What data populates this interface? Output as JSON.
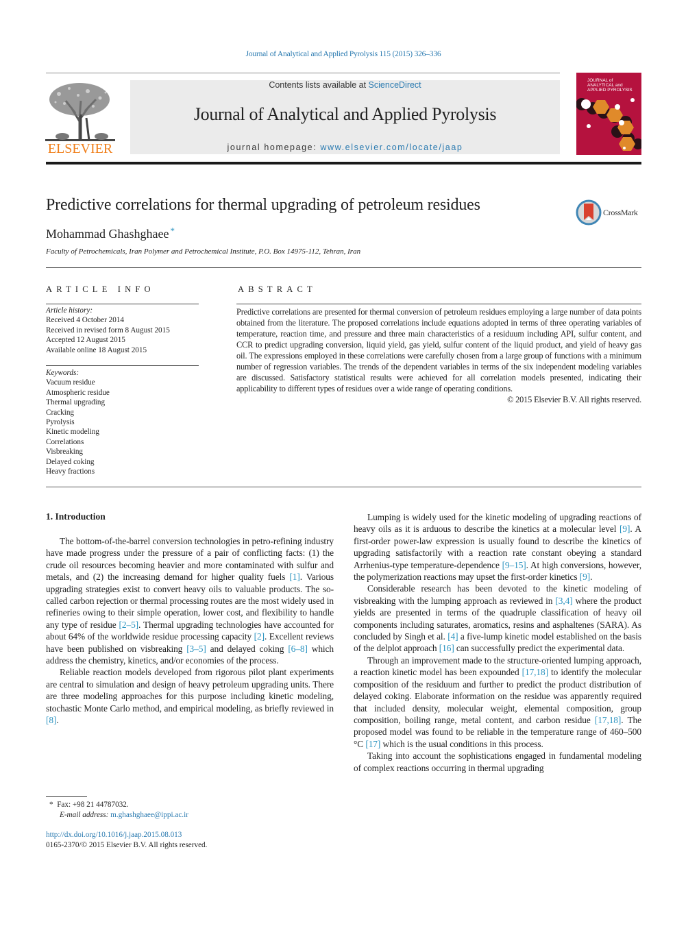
{
  "citation": "Journal of Analytical and Applied Pyrolysis 115 (2015) 326–336",
  "publisher": {
    "logo_word": "ELSEVIER",
    "brand_color": "#f07f1a"
  },
  "header": {
    "contents_prefix": "Contents lists available at ",
    "contents_link": "ScienceDirect",
    "journal_title": "Journal of Analytical and Applied Pyrolysis",
    "homepage_prefix": "journal homepage: ",
    "homepage_link": "www.elsevier.com/locate/jaap"
  },
  "cover": {
    "title_lines": [
      "JOURNAL of",
      "ANALYTICAL and",
      "APPLIED PYROLYSIS"
    ],
    "color": "#b5123e"
  },
  "article": {
    "title": "Predictive correlations for thermal upgrading of petroleum residues",
    "crossmark_label": "CrossMark",
    "author": "Mohammad Ghashghaee",
    "author_mark": "*",
    "affiliation": "Faculty of Petrochemicals, Iran Polymer and Petrochemical Institute, P.O. Box 14975-112, Tehran, Iran"
  },
  "article_info": {
    "heading": "ARTICLE INFO",
    "history_label": "Article history:",
    "history": [
      "Received 4 October 2014",
      "Received in revised form 8 August 2015",
      "Accepted 12 August 2015",
      "Available online 18 August 2015"
    ],
    "keywords_label": "Keywords:",
    "keywords": [
      "Vacuum residue",
      "Atmospheric residue",
      "Thermal upgrading",
      "Cracking",
      "Pyrolysis",
      "Kinetic modeling",
      "Correlations",
      "Visbreaking",
      "Delayed coking",
      "Heavy fractions"
    ]
  },
  "abstract": {
    "heading": "ABSTRACT",
    "text": "Predictive correlations are presented for thermal conversion of petroleum residues employing a large number of data points obtained from the literature. The proposed correlations include equations adopted in terms of three operating variables of temperature, reaction time, and pressure and three main characteristics of a residuum including API, sulfur content, and CCR to predict upgrading conversion, liquid yield, gas yield, sulfur content of the liquid product, and yield of heavy gas oil. The expressions employed in these correlations were carefully chosen from a large group of functions with a minimum number of regression variables. The trends of the dependent variables in terms of the six independent modeling variables are discussed. Satisfactory statistical results were achieved for all correlation models presented, indicating their applicability to different types of residues over a wide range of operating conditions.",
    "copyright": "© 2015 Elsevier B.V. All rights reserved."
  },
  "body": {
    "section_heading": "1.  Introduction",
    "left_paragraphs": [
      [
        {
          "t": "The bottom-of-the-barrel conversion technologies in petro-refining industry have made progress under the pressure of a pair of conflicting facts: (1) the crude oil resources becoming heavier and more contaminated with sulfur and metals, and (2) the increasing demand for higher quality fuels "
        },
        {
          "c": "[1]"
        },
        {
          "t": ". Various upgrading strategies exist to convert heavy oils to valuable products. The so-called carbon rejection or thermal processing routes are the most widely used in refineries owing to their simple operation, lower cost, and flexibility to handle any type of residue "
        },
        {
          "c": "[2–5]"
        },
        {
          "t": ". Thermal upgrading technologies have accounted for about 64% of the worldwide residue processing capacity "
        },
        {
          "c": "[2]"
        },
        {
          "t": ". Excellent reviews have been published on visbreaking "
        },
        {
          "c": "[3–5]"
        },
        {
          "t": " and delayed coking "
        },
        {
          "c": "[6–8]"
        },
        {
          "t": " which address the chemistry, kinetics, and/or economies of the process."
        }
      ],
      [
        {
          "t": "Reliable reaction models developed from rigorous pilot plant experiments are central to simulation and design of heavy petroleum upgrading units. There are three modeling approaches for this purpose including kinetic modeling, stochastic Monte Carlo method, and empirical modeling, as briefly reviewed in "
        },
        {
          "c": "[8]"
        },
        {
          "t": "."
        }
      ]
    ],
    "right_paragraphs": [
      [
        {
          "t": "Lumping is widely used for the kinetic modeling of upgrading reactions of heavy oils as it is arduous to describe the kinetics at a molecular level "
        },
        {
          "c": "[9]"
        },
        {
          "t": ". A first-order power-law expression is usually found to describe the kinetics of upgrading satisfactorily with a reaction rate constant obeying a standard Arrhenius-type temperature-dependence "
        },
        {
          "c": "[9–15]"
        },
        {
          "t": ". At high conversions, however, the polymerization reactions may upset the first-order kinetics "
        },
        {
          "c": "[9]"
        },
        {
          "t": "."
        }
      ],
      [
        {
          "t": "Considerable research has been devoted to the kinetic modeling of visbreaking with the lumping approach as reviewed in "
        },
        {
          "c": "[3,4]"
        },
        {
          "t": " where the product yields are presented in terms of the quadruple classification of heavy oil components including saturates, aromatics, resins and asphaltenes (SARA). As concluded by Singh et al. "
        },
        {
          "c": "[4]"
        },
        {
          "t": " a five-lump kinetic model established on the basis of the delplot approach "
        },
        {
          "c": "[16]"
        },
        {
          "t": " can successfully predict the experimental data."
        }
      ],
      [
        {
          "t": "Through an improvement made to the structure-oriented lumping approach, a reaction kinetic model has been expounded "
        },
        {
          "c": "[17,18]"
        },
        {
          "t": " to identify the molecular composition of the residuum and further to predict the product distribution of delayed coking. Elaborate information on the residue was apparently required that included density, molecular weight, elemental composition, group composition, boiling range, metal content, and carbon residue "
        },
        {
          "c": "[17,18]"
        },
        {
          "t": ". The proposed model was found to be reliable in the temperature range of 460–500 °C "
        },
        {
          "c": "[17]"
        },
        {
          "t": " which is the usual conditions in this process."
        }
      ],
      [
        {
          "t": "Taking into account the sophistications engaged in fundamental modeling of complex reactions occurring in thermal upgrading"
        }
      ]
    ]
  },
  "footnote": {
    "mark": "*",
    "fax": "Fax: +98 21 44787032.",
    "email_label": "E-mail address: ",
    "email": "m.ghashghaee@ippi.ac.ir"
  },
  "doi": {
    "link": "http://dx.doi.org/10.1016/j.jaap.2015.08.013",
    "issn_line": "0165-2370/© 2015 Elsevier B.V. All rights reserved."
  }
}
